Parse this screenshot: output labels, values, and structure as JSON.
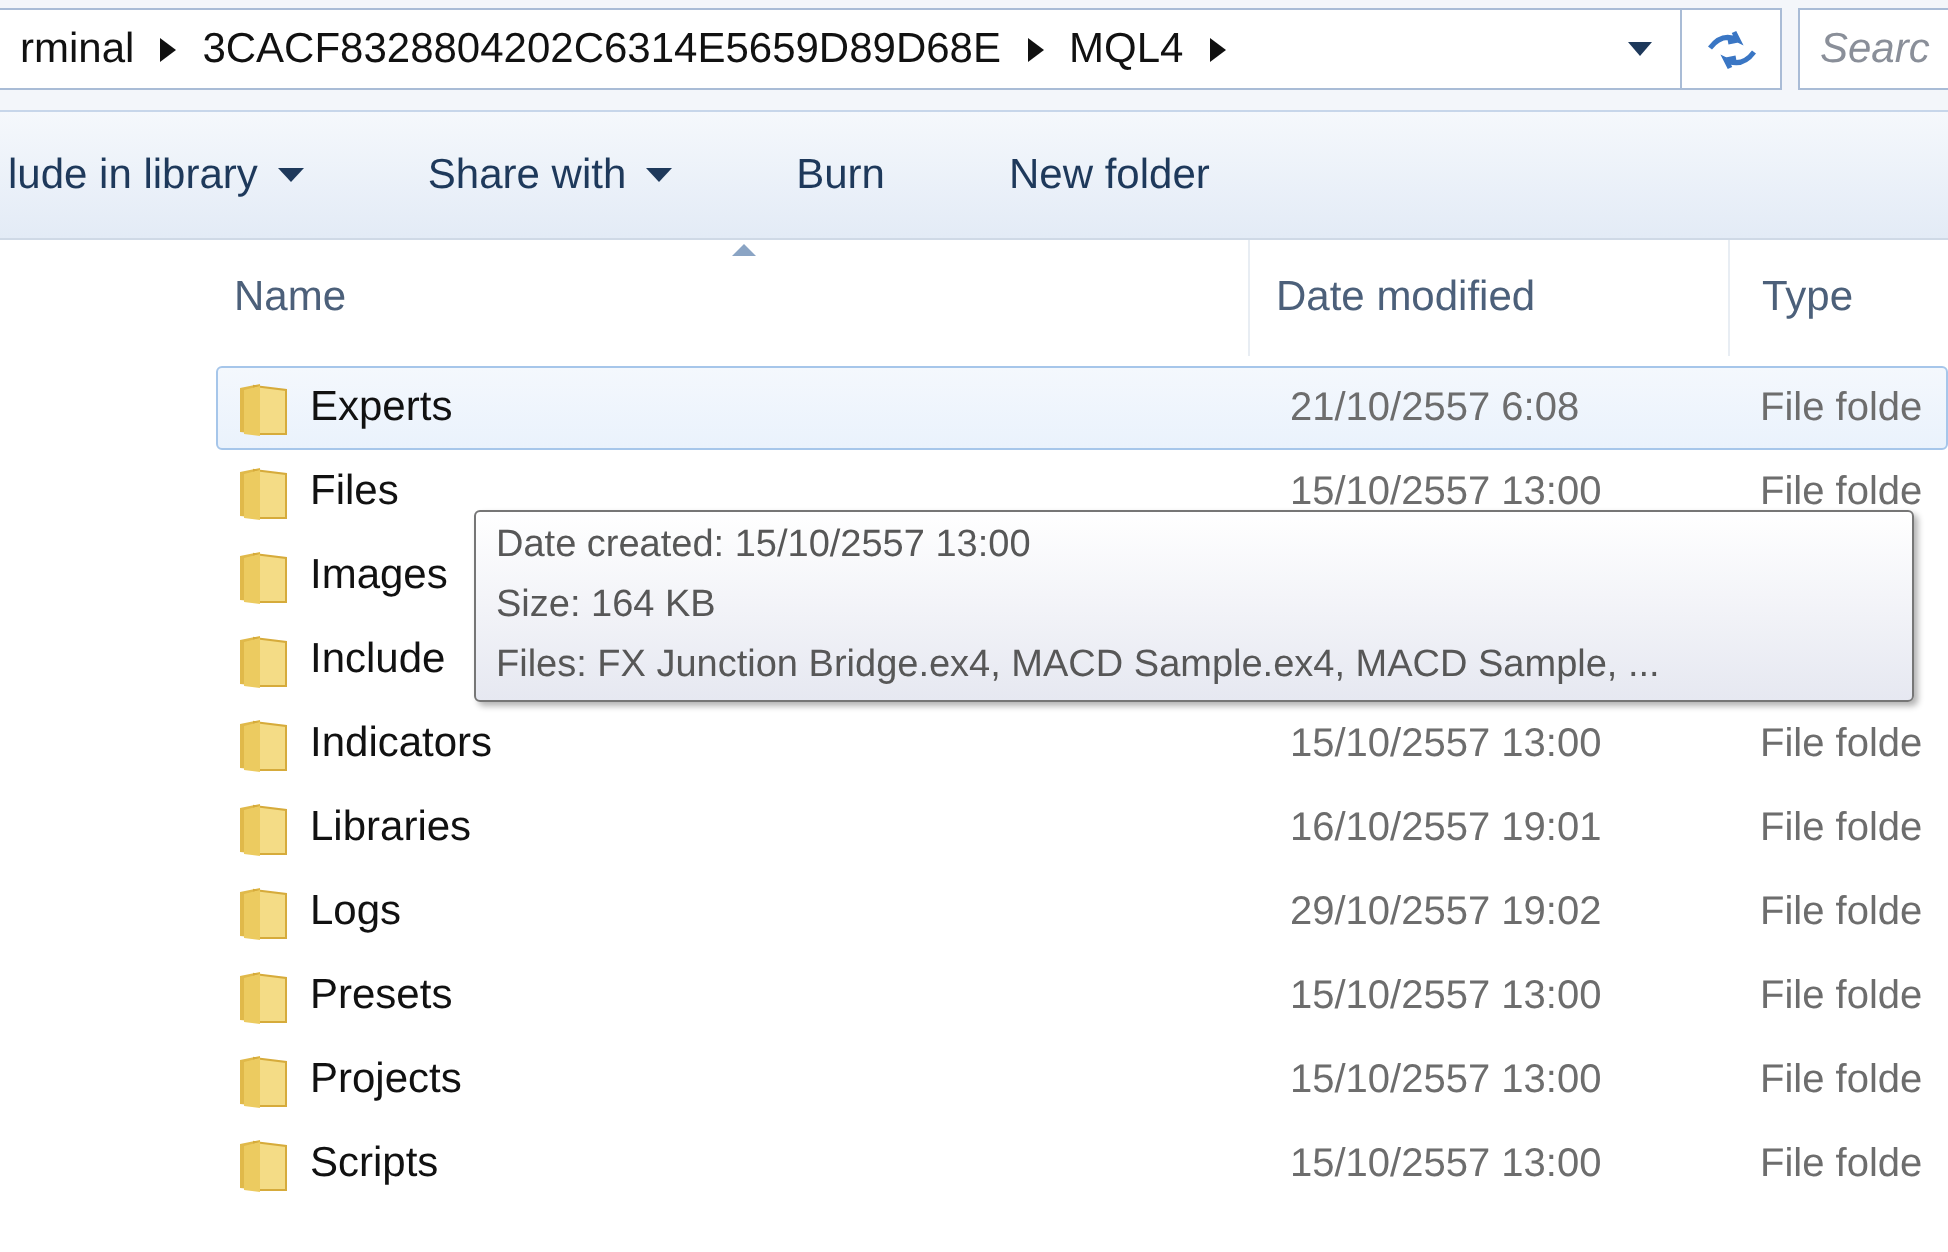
{
  "address_bar": {
    "crumbs": [
      "rminal",
      "3CACF8328804202C6314E5659D89D68E",
      "MQL4"
    ],
    "search": {
      "placeholder": "Searc"
    }
  },
  "toolbar": {
    "items": [
      {
        "label": "lude in library",
        "dropdown": true
      },
      {
        "label": "Share with",
        "dropdown": true
      },
      {
        "label": "Burn",
        "dropdown": false
      },
      {
        "label": "New folder",
        "dropdown": false
      }
    ]
  },
  "table": {
    "columns": [
      {
        "label": "Name",
        "sorted": true
      },
      {
        "label": "Date modified",
        "sorted": false
      },
      {
        "label": "Type",
        "sorted": false
      }
    ],
    "rows": [
      {
        "name": "Experts",
        "date": "21/10/2557 6:08",
        "type": "File folde",
        "selected": true
      },
      {
        "name": "Files",
        "date": "15/10/2557 13:00",
        "type": "File folde",
        "selected": false
      },
      {
        "name": "Images",
        "selected": false
      },
      {
        "name": "Include",
        "selected": false
      },
      {
        "name": "Indicators",
        "date": "15/10/2557 13:00",
        "type": "File folde",
        "selected": false
      },
      {
        "name": "Libraries",
        "date": "16/10/2557 19:01",
        "type": "File folde",
        "selected": false
      },
      {
        "name": "Logs",
        "date": "29/10/2557 19:02",
        "type": "File folde",
        "selected": false
      },
      {
        "name": "Presets",
        "date": "15/10/2557 13:00",
        "type": "File folde",
        "selected": false
      },
      {
        "name": "Projects",
        "date": "15/10/2557 13:00",
        "type": "File folde",
        "selected": false
      },
      {
        "name": "Scripts",
        "date": "15/10/2557 13:00",
        "type": "File folde",
        "selected": false
      }
    ]
  },
  "tooltip": {
    "lines": [
      "Date created: 15/10/2557 13:00",
      "Size: 164 KB",
      "Files: FX Junction Bridge.ex4, MACD Sample.ex4, MACD Sample, ..."
    ]
  }
}
